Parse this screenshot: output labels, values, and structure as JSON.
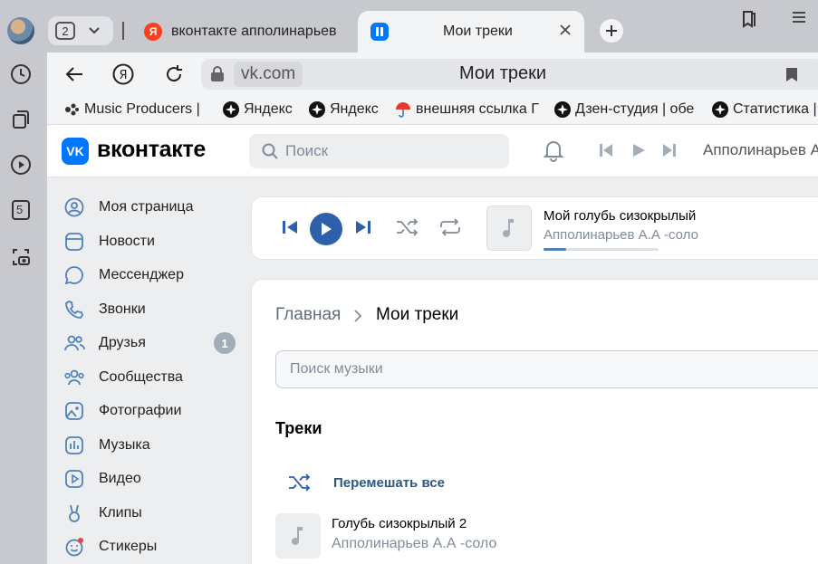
{
  "browser": {
    "tab_count": "2",
    "tabs": [
      {
        "title": "вконтакте апполинарьев"
      },
      {
        "title": "Мои треки"
      }
    ],
    "address": {
      "domain": "vk.com",
      "page_title": "Мои треки"
    },
    "bookmarks": [
      {
        "label": "Music Producers |",
        "icon": "music-producers-icon"
      },
      {
        "label": "Яндекс",
        "icon": "star-icon"
      },
      {
        "label": "Яндекс",
        "icon": "star-icon"
      },
      {
        "label": "внешняя ссылка Г",
        "icon": "umbrella-icon"
      },
      {
        "label": "Дзен-студия | обе",
        "icon": "star-icon"
      },
      {
        "label": "Статистика |",
        "icon": "star-icon"
      }
    ],
    "sidebar_badge": "5",
    "colors": {
      "chrome": "#c7c9cf",
      "toolbar": "#f3f4f6"
    }
  },
  "vk": {
    "logo_text": "вконтакте",
    "logo_mark": "VK",
    "search_placeholder": "Поиск",
    "header_user": "Апполинарьев А.",
    "menu": [
      {
        "label": "Моя страница",
        "icon": "user-circle-icon"
      },
      {
        "label": "Новости",
        "icon": "news-icon"
      },
      {
        "label": "Мессенджер",
        "icon": "message-icon"
      },
      {
        "label": "Звонки",
        "icon": "phone-icon"
      },
      {
        "label": "Друзья",
        "icon": "friends-icon",
        "badge": "1"
      },
      {
        "label": "Сообщества",
        "icon": "communities-icon"
      },
      {
        "label": "Фотографии",
        "icon": "photo-icon"
      },
      {
        "label": "Музыка",
        "icon": "music-icon"
      },
      {
        "label": "Видео",
        "icon": "video-icon"
      },
      {
        "label": "Клипы",
        "icon": "clips-icon"
      },
      {
        "label": "Стикеры",
        "icon": "stickers-icon"
      }
    ],
    "player": {
      "title": "Мой голубь сизокрылый",
      "artist": "Апполинарьев А.А -соло",
      "progress": 0.2
    },
    "breadcrumb": {
      "home": "Главная",
      "current": "Мои треки"
    },
    "music_search_placeholder": "Поиск музыки",
    "tracks_heading": "Треки",
    "shuffle_label": "Перемешать все",
    "tracks": [
      {
        "title": "Голубь сизокрылый 2",
        "artist": "Апполинарьев А.А -соло"
      }
    ],
    "colors": {
      "accent": "#0077ff",
      "play": "#2d5faa",
      "link": "#2a5885",
      "secondary": "#818c99"
    }
  }
}
